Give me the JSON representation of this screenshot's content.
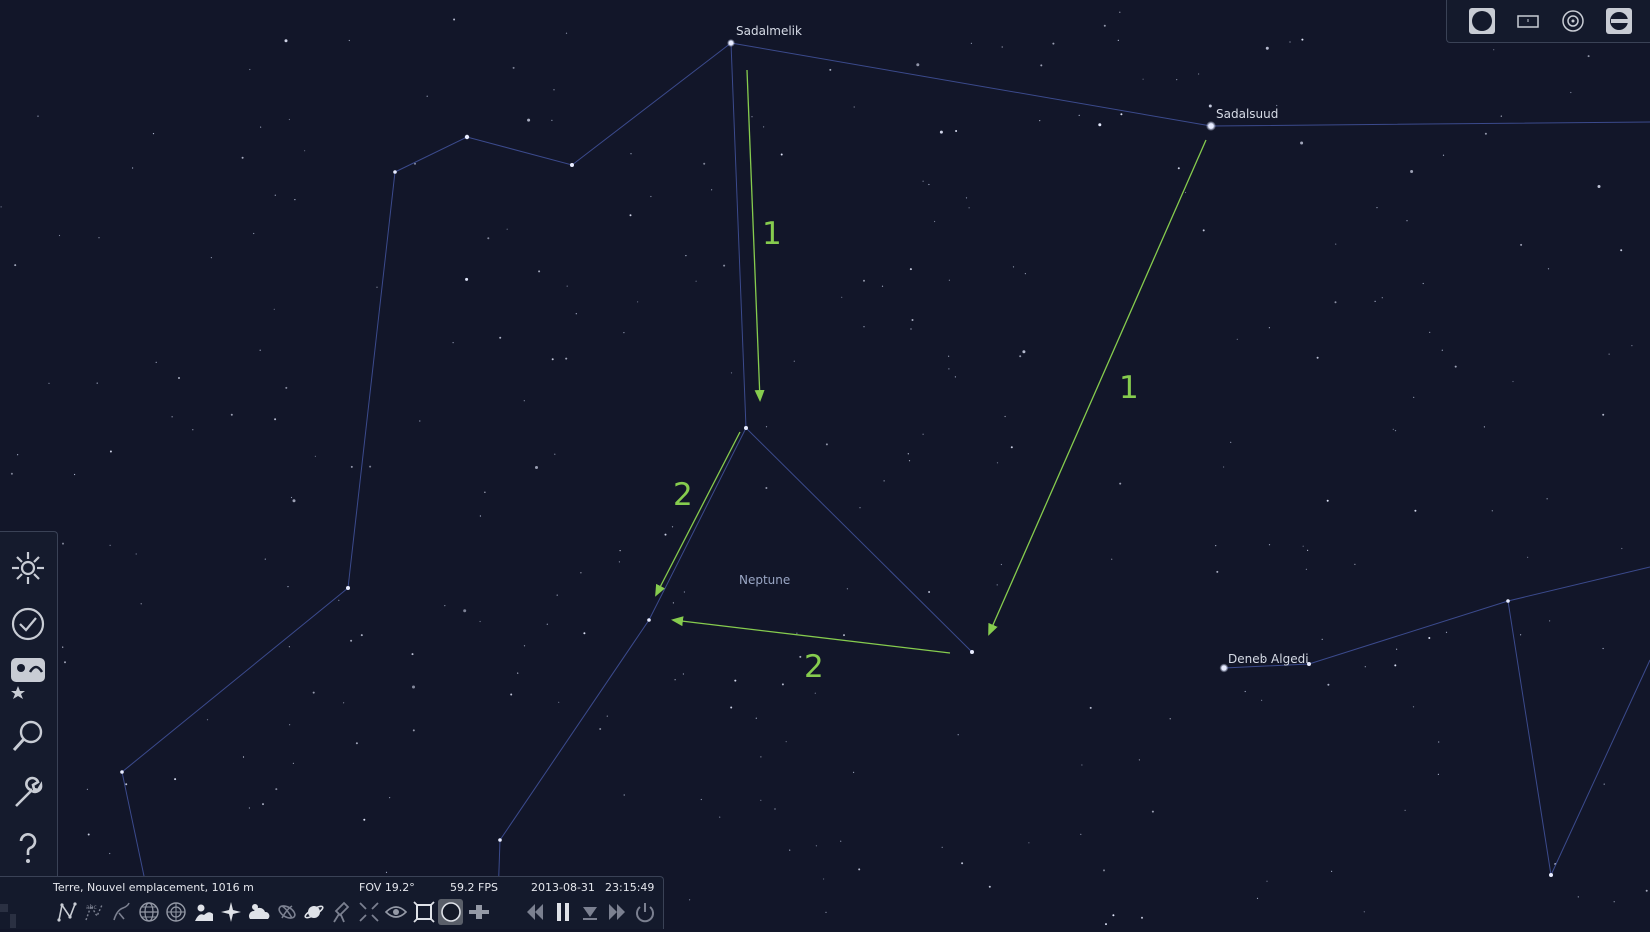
{
  "sky": {
    "star_labels": {
      "sadalmelik": "Sadalmelik",
      "sadalsuud": "Sadalsuud",
      "deneb_algedi": "Deneb Algedi"
    },
    "planet_label": "Neptune",
    "annotations": [
      "1",
      "1",
      "2",
      "2"
    ],
    "colors": {
      "background": "#121629",
      "constellation_lines": "#3b4a8c",
      "annotation": "#86cc4e"
    }
  },
  "top_toolbar": {
    "items": [
      "circle-filled-icon",
      "rectangle-icon",
      "target-icon",
      "ocular-icon"
    ]
  },
  "left_bar": {
    "items": [
      "sky-display-icon",
      "date-time-icon",
      "sky-viewing-options-icon",
      "search-icon",
      "configuration-icon",
      "help-icon"
    ]
  },
  "status_bar": {
    "location": "Terre, Nouvel emplacement, 1016 m",
    "fov": "FOV 19.2°",
    "fps": "59.2 FPS",
    "date": "2013-08-31",
    "time": "23:15:49"
  },
  "bottom_toolbar": {
    "buttons": [
      "constellation-lines-icon",
      "constellation-labels-icon",
      "constellation-art-icon",
      "equatorial-grid-icon",
      "azimuthal-grid-icon",
      "ground-icon",
      "cardinal-points-icon",
      "atmosphere-icon",
      "deep-sky-icon",
      "planet-labels-icon",
      "equatorial-mount-icon",
      "center-on-selection-icon",
      "night-mode-icon",
      "fullscreen-icon",
      "oculars-icon",
      "satellite-icon",
      "rewind-icon",
      "pause-icon",
      "real-time-icon",
      "fast-forward-icon",
      "quit-icon"
    ]
  }
}
